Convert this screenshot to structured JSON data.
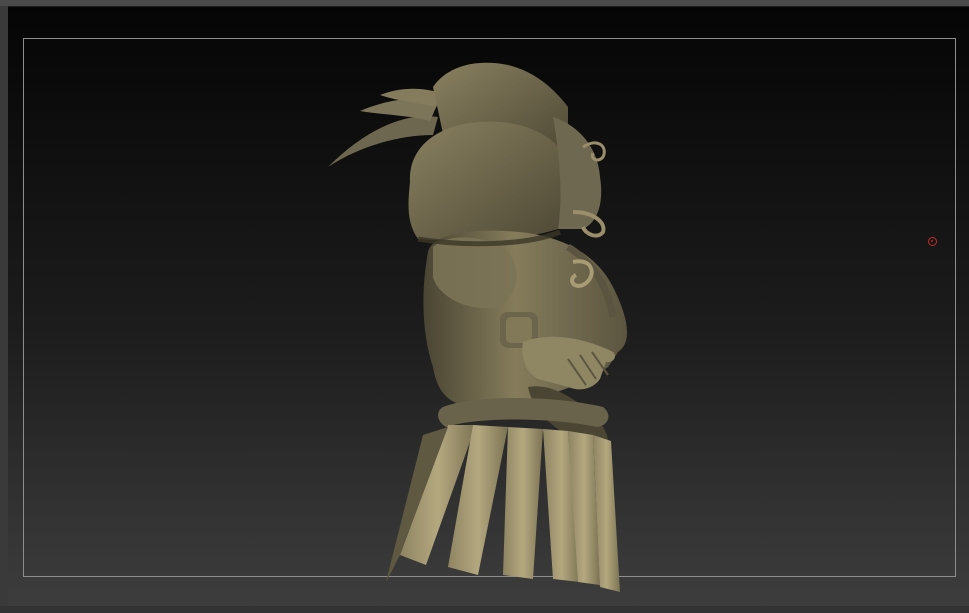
{
  "viewport": {
    "background_top": "#050505",
    "background_bottom": "#3d3d3d",
    "frame_color": "#8d8d8d"
  },
  "model": {
    "material_color": "#7a7254",
    "highlight_color": "#a89c74",
    "shadow_color": "#3b3727"
  },
  "pivot": {
    "icon": "target-icon",
    "color": "#c0282a"
  }
}
